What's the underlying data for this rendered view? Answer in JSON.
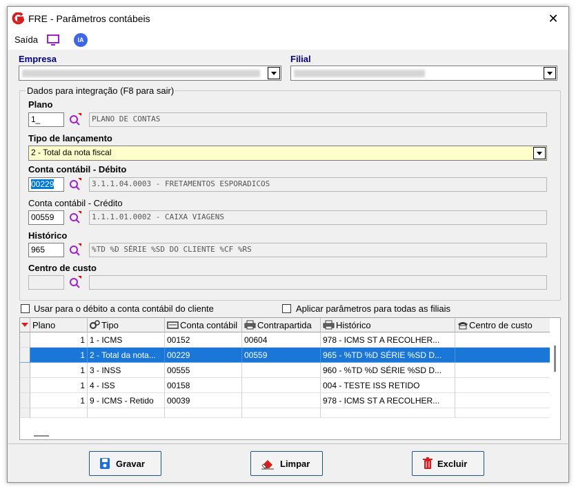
{
  "window": {
    "title": "FRE - Parâmetros contábeis",
    "close": "✕"
  },
  "toolbar": {
    "saida": "Saída",
    "ia": "IA"
  },
  "empresa": {
    "label": "Empresa"
  },
  "filial": {
    "label": "Filial"
  },
  "group": {
    "caption": "Dados para integração  (F8 para sair)"
  },
  "plano": {
    "label": "Plano",
    "code": "1_",
    "desc": "PLANO DE CONTAS"
  },
  "tipo": {
    "label": "Tipo de lançamento",
    "value": "2 - Total da nota fiscal"
  },
  "debito": {
    "label": "Conta contábil - Débito",
    "code": "00229",
    "desc": "3.1.1.04.0003 - FRETAMENTOS ESPORADICOS"
  },
  "credito": {
    "label": "Conta contábil - Crédito",
    "code": "00559",
    "desc": "1.1.1.01.0002 - CAIXA VIAGENS"
  },
  "historico": {
    "label": "Histórico",
    "code": "965",
    "desc": "%TD %D SÉRIE %SD DO CLIENTE %CF %RS"
  },
  "centro": {
    "label": "Centro de custo",
    "code": "",
    "desc": ""
  },
  "options": {
    "usar_debito": "Usar para o débito a conta contábil do cliente",
    "aplicar_filiais": "Aplicar parâmetros para todas as filiais"
  },
  "grid": {
    "headers": [
      "Plano",
      "Tipo",
      "Conta contábil",
      "Contrapartida",
      "Histórico",
      "Centro de custo"
    ],
    "rows": [
      [
        "1",
        "1 - ICMS",
        "00152",
        "00604",
        "978 - ICMS ST A RECOLHER...",
        ""
      ],
      [
        "1",
        "2 - Total da nota...",
        "00229",
        "00559",
        "965 - %TD %D SÉRIE %SD D...",
        ""
      ],
      [
        "1",
        "3 - INSS",
        "00555",
        "",
        "960 - %TD %D SÉRIE %SD D...",
        ""
      ],
      [
        "1",
        "4 - ISS",
        "00158",
        "",
        "004 - TESTE ISS RETIDO",
        ""
      ],
      [
        "1",
        "9 - ICMS - Retido",
        "00039",
        "",
        "978 - ICMS ST A RECOLHER...",
        ""
      ],
      [
        "",
        "",
        "",
        "",
        "",
        ""
      ]
    ]
  },
  "buttons": {
    "gravar": "Gravar",
    "limpar": "Limpar",
    "excluir": "Excluir"
  },
  "colors": {
    "selected_row": "#1a77d8",
    "brand_red": "#d42020",
    "label_blue": "#000080",
    "highlight_field": "#ffffcc"
  }
}
